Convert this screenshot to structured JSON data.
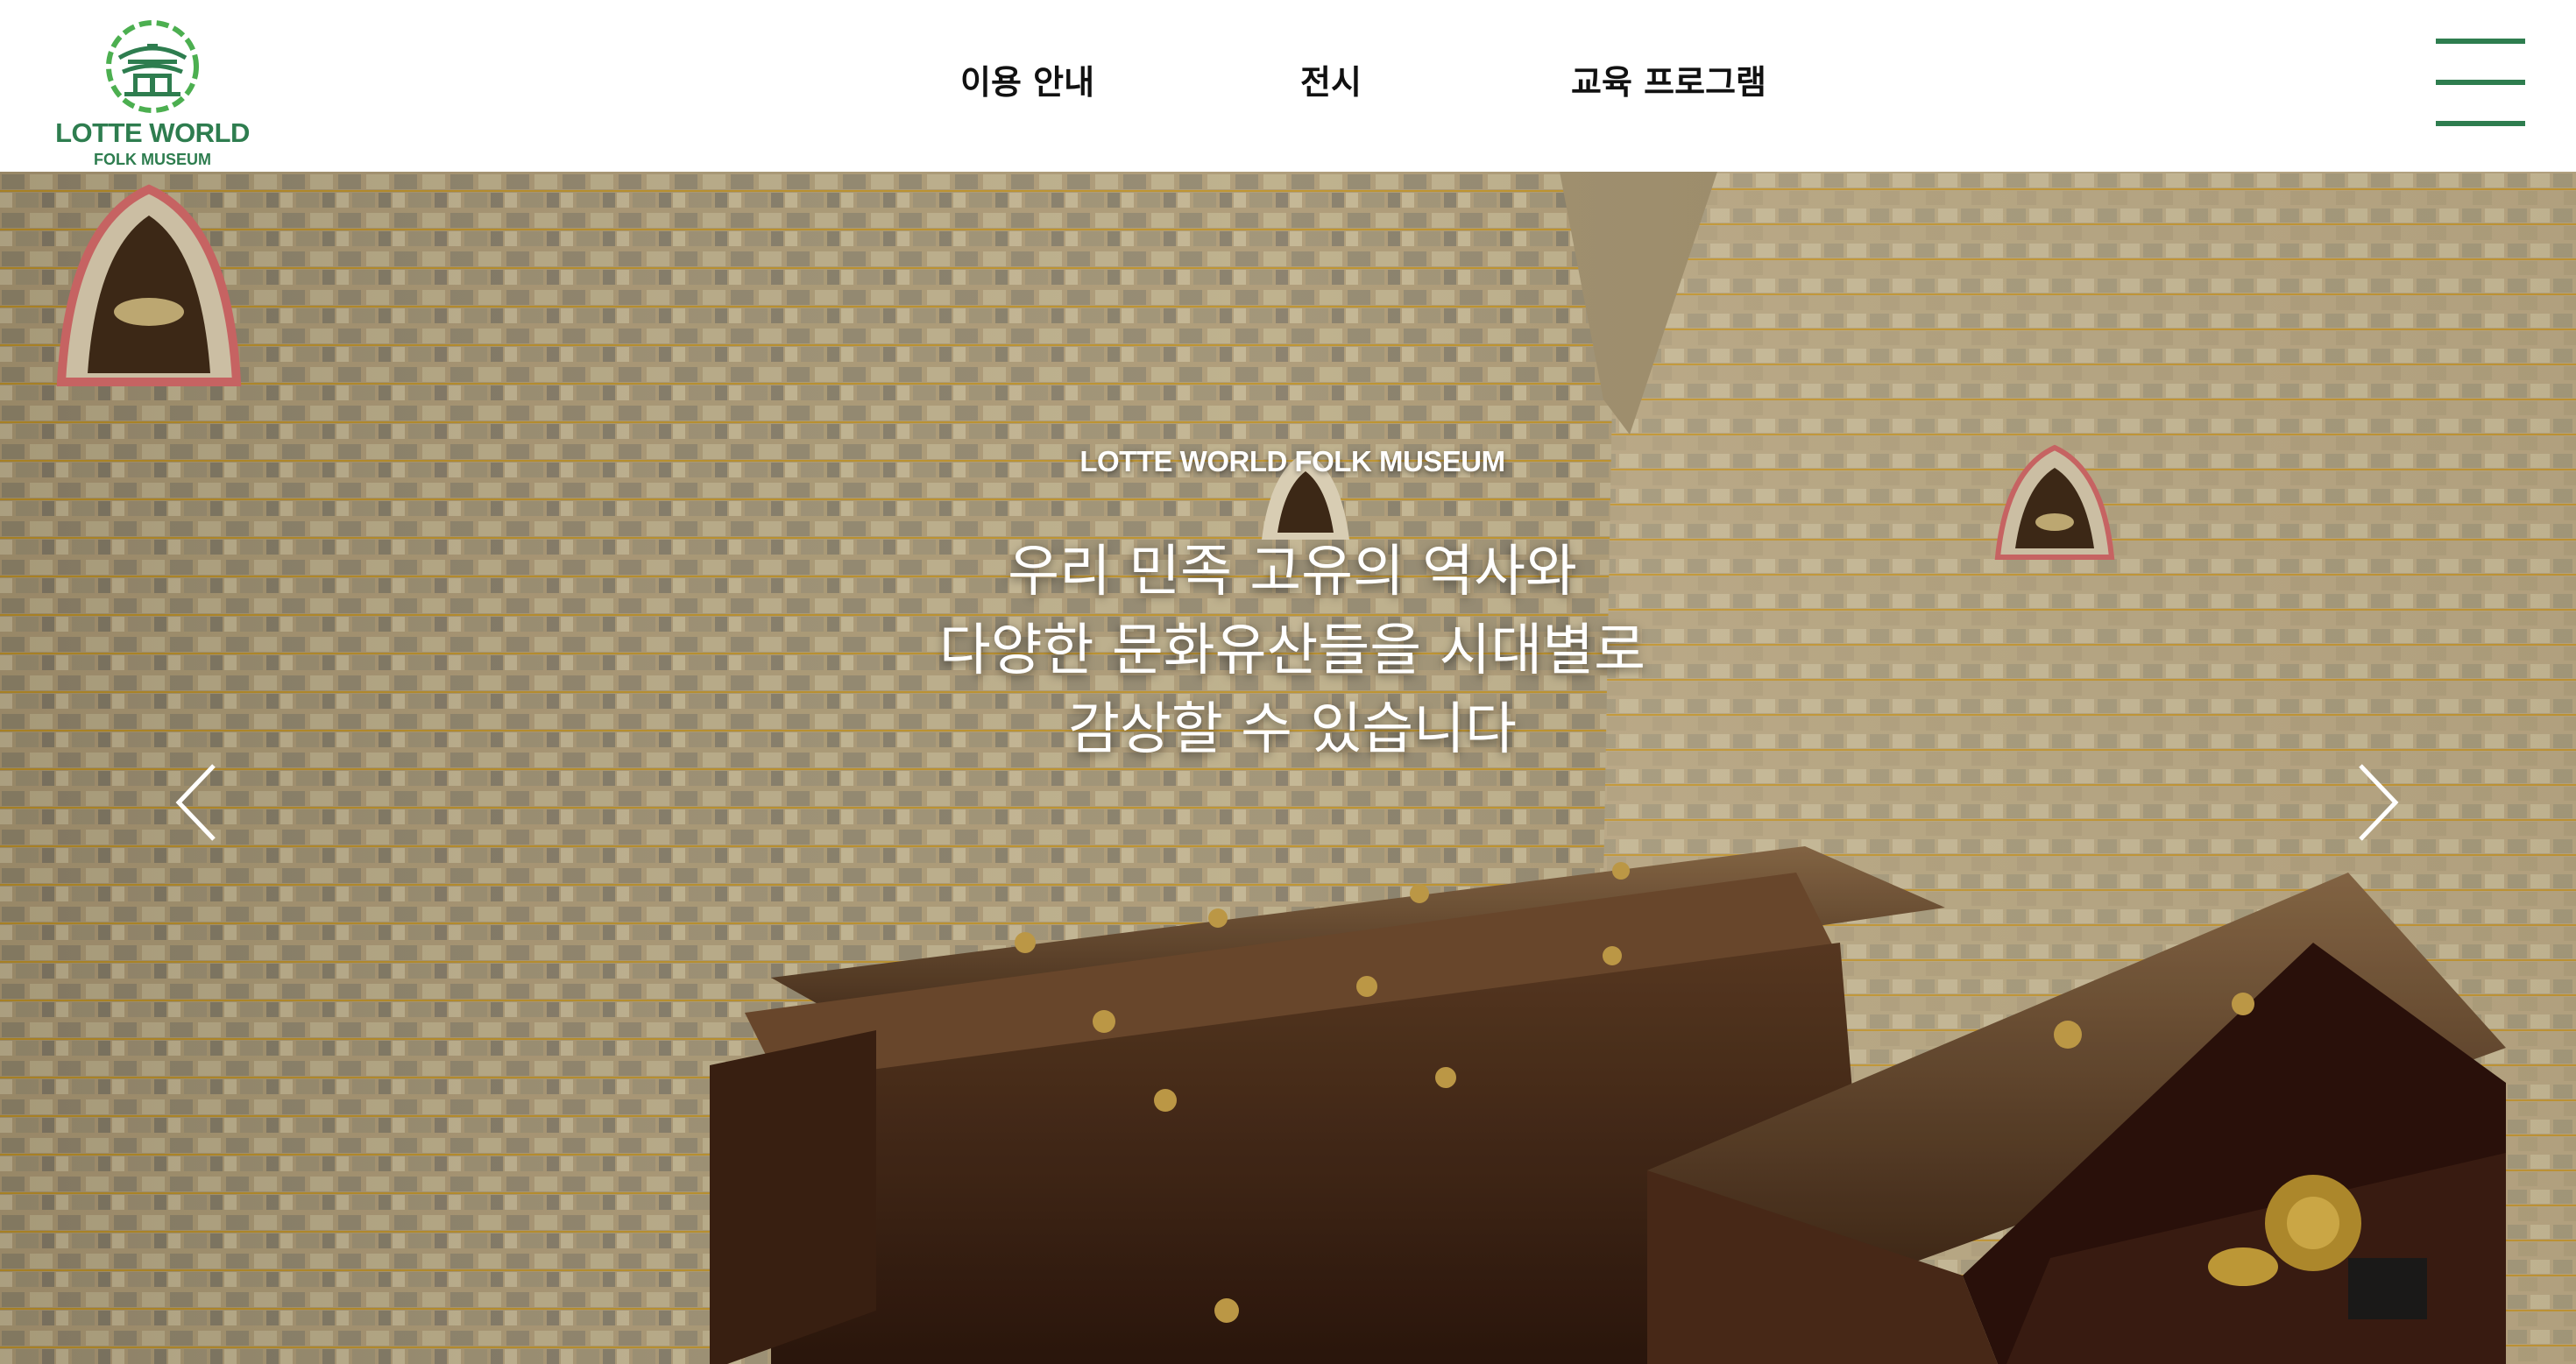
{
  "brand": {
    "name": "LOTTE WORLD",
    "sub": "FOLK MUSEUM",
    "color": "#2e7d4f"
  },
  "nav": {
    "items": [
      {
        "label": "이용 안내"
      },
      {
        "label": "전시"
      },
      {
        "label": "교육 프로그램"
      }
    ],
    "menu_icon": "hamburger-icon"
  },
  "hero": {
    "eyebrow": "LOTTE WORLD FOLK MUSEUM",
    "headline": [
      "우리 민족 고유의 역사와",
      "다양한 문화유산들을 시대별로",
      "감상할 수 있습니다"
    ],
    "prev_icon": "chevron-left-icon",
    "next_icon": "chevron-right-icon"
  }
}
